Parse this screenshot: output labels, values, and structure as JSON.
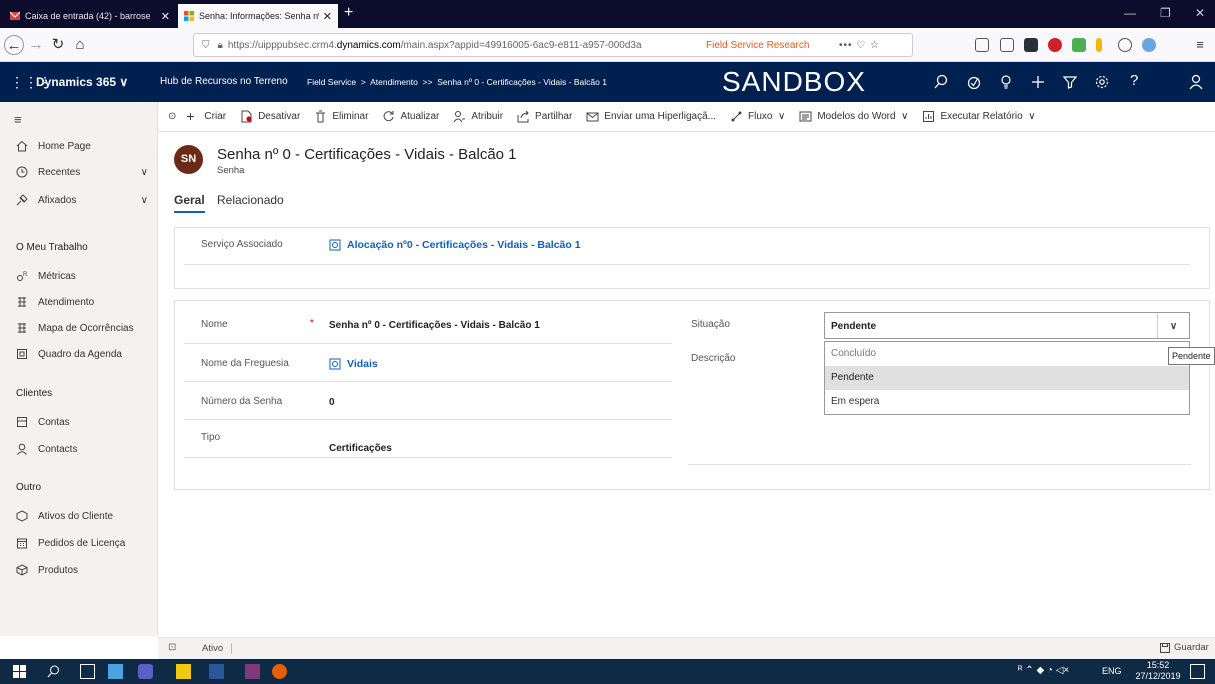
{
  "browser": {
    "tabs": [
      {
        "title": "Caixa de entrada (42) - barrose"
      },
      {
        "title": "Senha: Informações: Senha nº "
      }
    ],
    "url_prefix": "https://uipppubsec.crm4.",
    "url_domain": "dynamics.com",
    "url_rest": "/main.aspx?appid=49916005-6ac9-e811-a957-000d3a",
    "field_service_research": "Field Service Research"
  },
  "header": {
    "app": "Dynamics 365",
    "hub": "Hub de Recursos no Terreno",
    "breadcrumb": [
      "Field Service",
      "Atendimento",
      "Senha nº 0 - Certificações - Vidais - Balcão 1"
    ],
    "env": "SANDBOX"
  },
  "commands": [
    "Criar",
    "Desativar",
    "Eliminar",
    "Atualizar",
    "Atribuir",
    "Partilhar",
    "Enviar uma Hiperligaçã...",
    "Fluxo",
    "Modelos do Word",
    "Executar Relatório"
  ],
  "sidebar": {
    "top": [
      "Home Page",
      "Recentes",
      "Afixados"
    ],
    "groups": [
      {
        "title": "O Meu Trabalho",
        "items": [
          "Métricas",
          "Atendimento",
          "Mapa de Ocorrências",
          "Quadro da Agenda"
        ]
      },
      {
        "title": "Clientes",
        "items": [
          "Contas",
          "Contacts"
        ]
      },
      {
        "title": "Outro",
        "items": [
          "Ativos do Cliente",
          "Pedidos de Licença",
          "Produtos"
        ]
      }
    ]
  },
  "form": {
    "avatar": "SN",
    "title": "Senha nº 0 - Certificações - Vidais - Balcão 1",
    "entity": "Senha",
    "tabs": [
      "Geral",
      "Relacionado"
    ],
    "servico_label": "Serviço Associado",
    "servico_value": "Alocação nº0 - Certificações - Vidais - Balcão 1",
    "nome_label": "Nome",
    "required_mark": "*",
    "nome_value": "Senha nº 0 - Certificações - Vidais - Balcão 1",
    "freguesia_label": "Nome da Freguesia",
    "freguesia_value": "Vidais",
    "numero_label": "Número da Senha",
    "numero_value": "0",
    "tipo_label": "Tipo",
    "tipo_value": "Certificações",
    "situacao_label": "Situação",
    "situacao_value": "Pendente",
    "descricao_label": "Descrição",
    "options": [
      "Concluído",
      "Pendente",
      "Em espera"
    ],
    "tooltip": "Pendente"
  },
  "status": {
    "state": "Ativo",
    "save": "Guardar"
  },
  "taskbar": {
    "lang": "ENG",
    "time": "15:52",
    "date": "27/12/2019"
  },
  "colors": {
    "header": "#002050",
    "link": "#1160b7",
    "sidebar": "#f3f2f1",
    "avatar": "#6b2a17"
  }
}
